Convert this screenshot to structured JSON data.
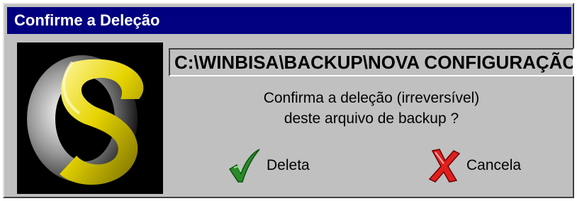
{
  "window": {
    "title": "Confirme a Deleção"
  },
  "path": "C:\\WINBISA\\BACKUP\\NOVA CONFIGURAÇÃO",
  "message": {
    "line1": "Confirma a deleção (irreversível)",
    "line2": "deste arquivo de backup ?"
  },
  "buttons": {
    "delete": "Deleta",
    "cancel": "Cancela"
  },
  "icons": {
    "logo": "yellow-s-logo-icon",
    "delete": "green-check-icon",
    "cancel": "red-x-icon"
  },
  "colors": {
    "titlebar": "#000080",
    "dialog": "#c0c0c0",
    "check": "#2a8a2a",
    "x": "#e0201e",
    "logo": "#e8d800"
  }
}
